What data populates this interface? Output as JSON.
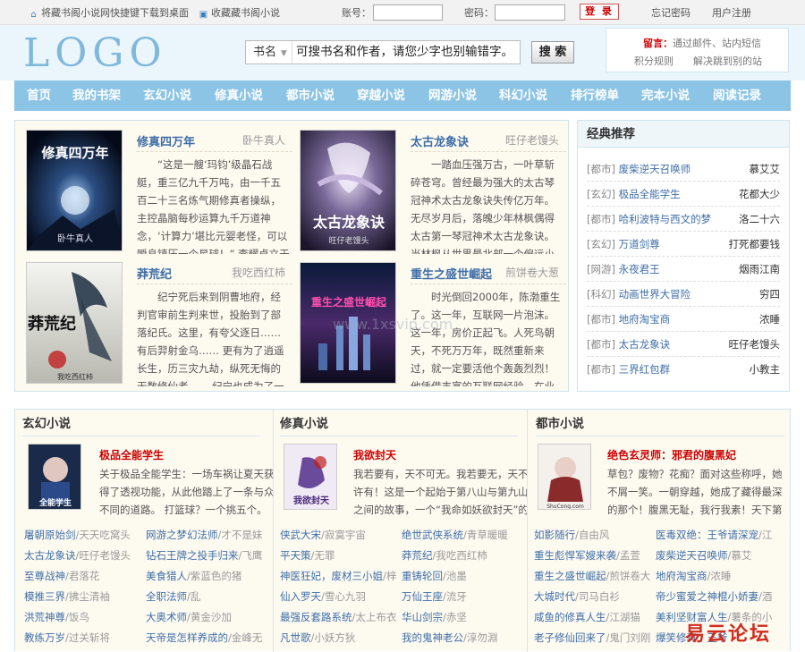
{
  "topbar": {
    "shortcut": "将藏书阁小说网快捷键下载到桌面",
    "favorite": "收藏藏书阁小说",
    "account_label": "账号：",
    "password_label": "密码：",
    "login": "登 录",
    "forgot": "忘记密码",
    "register": "用户注册"
  },
  "header": {
    "logo": "LOGO",
    "search_select": "书名",
    "search_text": "可搜书名和作者，请您少字也别输错字。",
    "search_button": "搜 索",
    "notice_label": "留言：",
    "notice_text": "通过邮件、站内短信",
    "points": "积分规则",
    "redirect": "解决跳到别的站"
  },
  "nav": [
    "首页",
    "我的书架",
    "玄幻小说",
    "修真小说",
    "都市小说",
    "穿越小说",
    "网游小说",
    "科幻小说",
    "排行榜单",
    "完本小说",
    "阅读记录"
  ],
  "featured": [
    {
      "title": "修真四万年",
      "author": "卧牛真人",
      "desc": "“这是一艘‘玛钧’级晶石战艇，重三亿九千万吨，由一千五百二十三名炼气期修真者操纵，主控晶脑每秒运算九千万道神念，‘计算力’堪比元婴老怪，可以瞬息镇压一个星球！” 李耀卓立于无尽星"
    },
    {
      "title": "太古龙象诀",
      "author": "旺仔老馒头",
      "desc": "一踏血压强万古，一叶草斩碎苍穹。曾经最为强大的太古琴冠神术太古龙象诀失传亿万年。无尽岁月后，落魄少年林枫偶得太古第一琴冠神术太古龙象诀。当林枫从世界最北部一个偏远小城走出之后，"
    },
    {
      "title": "莽荒纪",
      "author": "我吃西红柿",
      "desc": "纪宁死后来到阴曹地府，经判官审前生判来世，投胎到了部落纪氏。这里，有夸父逐日…… 有后羿射金乌…… 更有为了逍遥长生，历三灾九劫，纵死无悔的无数修仙者…… 纪宁也成为了一名修"
    },
    {
      "title": "重生之盛世崛起",
      "author": "煎饼卷大葱",
      "desc": "时光倒回2000年，陈渤重生了。这一年，互联网一片泡沫。这一年，房价正起飞。人死鸟朝天，不死万万年，既然重新来过，就一定要活他个轰轰烈烈！他凭借丰富的互联网经验，在业界横冲直"
    }
  ],
  "recommend": {
    "title": "经典推荐",
    "items": [
      {
        "cat": "[都市]",
        "book": "废柴逆天召唤师",
        "author": "慕艾艾"
      },
      {
        "cat": "[玄幻]",
        "book": "极品全能学生",
        "author": "花都大少"
      },
      {
        "cat": "[都市]",
        "book": "哈利波特与西文的梦",
        "author": "洛二十六"
      },
      {
        "cat": "[玄幻]",
        "book": "万道剑尊",
        "author": "打死都要钱"
      },
      {
        "cat": "[网游]",
        "book": "永夜君王",
        "author": "烟雨江南"
      },
      {
        "cat": "[科幻]",
        "book": "动画世界大冒险",
        "author": "穷四"
      },
      {
        "cat": "[都市]",
        "book": "地府淘宝商",
        "author": "浓睡"
      },
      {
        "cat": "[都市]",
        "book": "太古龙象诀",
        "author": "旺仔老馒头"
      },
      {
        "cat": "[都市]",
        "book": "三界红包群",
        "author": "小教主"
      }
    ]
  },
  "columns": [
    {
      "title": "玄幻小说",
      "feat_title": "极品全能学生",
      "feat_desc": "关于极品全能学生：一场车祸让夏天获得了透视功能，从此他踏上了一条与众不同的道路。 打篮球？一个挑五个。 围棋",
      "list": [
        [
          {
            "n": "屠朝原始剑",
            "s": "/",
            "a": "天天吃窝头"
          },
          {
            "n": "网游之梦幻法师",
            "s": "/",
            "a": "才不是妹"
          }
        ],
        [
          {
            "n": "太古龙象诀",
            "s": "/",
            "a": "旺仔老馒头"
          },
          {
            "n": "钻石王牌之投手归来",
            "s": "/",
            "a": "飞鹰"
          }
        ],
        [
          {
            "n": "至尊战神",
            "s": "/",
            "a": "君落花"
          },
          {
            "n": "美食猎人",
            "s": "/",
            "a": "紫蓝色的猪"
          }
        ],
        [
          {
            "n": "模推三界",
            "s": "/",
            "a": "拂尘清袖"
          },
          {
            "n": "全职法师",
            "s": "/",
            "a": "乱"
          }
        ],
        [
          {
            "n": "洪荒神尊",
            "s": "/",
            "a": "饭鸟"
          },
          {
            "n": "大奥术师",
            "s": "/",
            "a": "黄金沙加"
          }
        ],
        [
          {
            "n": "教练万岁",
            "s": "/",
            "a": "过关斩将"
          },
          {
            "n": "天帝是怎样养成的",
            "s": "/",
            "a": "金峰无"
          }
        ]
      ]
    },
    {
      "title": "修真小说",
      "feat_title": "我欲封天",
      "feat_desc": "我若要有，天不可无。我若要无，天不许有！这是一个起始于第八山与第九山之间的故事，一个“我命如妖欲封天”的世",
      "list": [
        [
          {
            "n": "侠武大宋",
            "s": "/",
            "a": "寂寞宇宙"
          },
          {
            "n": "绝世武侠系统",
            "s": "/",
            "a": "青草暖暖"
          }
        ],
        [
          {
            "n": "平天策",
            "s": "/",
            "a": "无罪"
          },
          {
            "n": "莽荒纪",
            "s": "/",
            "a": "我吃西红柿"
          }
        ],
        [
          {
            "n": "神医狂妃，废材三小姐",
            "s": "/",
            "a": "梓"
          },
          {
            "n": "重铸轮回",
            "s": "/",
            "a": "池墨"
          }
        ],
        [
          {
            "n": "仙入罗天",
            "s": "/",
            "a": "雪心九羽"
          },
          {
            "n": "万仙王座",
            "s": "/",
            "a": "流牙"
          }
        ],
        [
          {
            "n": "最强反套路系统",
            "s": "/",
            "a": "太上布衣"
          },
          {
            "n": "华山剑宗",
            "s": "/",
            "a": "赤坚"
          }
        ],
        [
          {
            "n": "凡世歌",
            "s": "/",
            "a": "小妖方狄"
          },
          {
            "n": "我的鬼神老公",
            "s": "/",
            "a": "淳勿淵"
          }
        ]
      ]
    },
    {
      "title": "都市小说",
      "feat_title": "绝色玄灵师：邪君的腹黑妃",
      "feat_desc": "草包？废物？花痴？面对这些称呼，她不屑一笑。一朝穿越，她成了藏得最深的那个！腹黑无耻，我行我素！天下第一杀",
      "list": [
        [
          {
            "n": "如影随行",
            "s": "/",
            "a": "自由风"
          },
          {
            "n": "医毒双绝：王爷请深宠",
            "s": "/",
            "a": "江"
          }
        ],
        [
          {
            "n": "重生彪悍军嫂来袭",
            "s": "/",
            "a": "孟萱"
          },
          {
            "n": "废柴逆天召唤师",
            "s": "/",
            "a": "慕艾"
          }
        ],
        [
          {
            "n": "重生之盛世崛起",
            "s": "/",
            "a": "煎饼卷大"
          },
          {
            "n": "地府淘宝商",
            "s": "/",
            "a": "浓睡"
          }
        ],
        [
          {
            "n": "大城时代",
            "s": "/",
            "a": "司马白衫"
          },
          {
            "n": "帝少蜜爱之神棍小娇妻",
            "s": "/",
            "a": "酒"
          }
        ],
        [
          {
            "n": "咸鱼的修真人生",
            "s": "/",
            "a": "江湖猫"
          },
          {
            "n": "美利坚财富人生",
            "s": "/",
            "a": "薯条的小"
          }
        ],
        [
          {
            "n": "老子修仙回来了",
            "s": "/",
            "a": "鬼门刘刚"
          },
          {
            "n": "爆笑修真：王爷",
            "s": "",
            "a": ""
          }
        ]
      ]
    }
  ],
  "cover_art": {
    "c1": "修真四万年",
    "c1b": "卧牛真人",
    "c2": "太古龙象诀",
    "c2b": "旺仔老馒头",
    "c3": "莽荒纪",
    "c3b": "我吃西红柿",
    "c4": "重生之盛世崛起",
    "c5": "全能学生",
    "c6": "我欲封天",
    "c7": "ShuCong.com",
    "watermark_site": "www.1xsvip.com"
  },
  "watermark": "易云论坛",
  "colors": {
    "nav": "#8cc4e6",
    "link": "#3f6ea8",
    "accent": "#cc0000",
    "panel": "#fdfaf0"
  }
}
